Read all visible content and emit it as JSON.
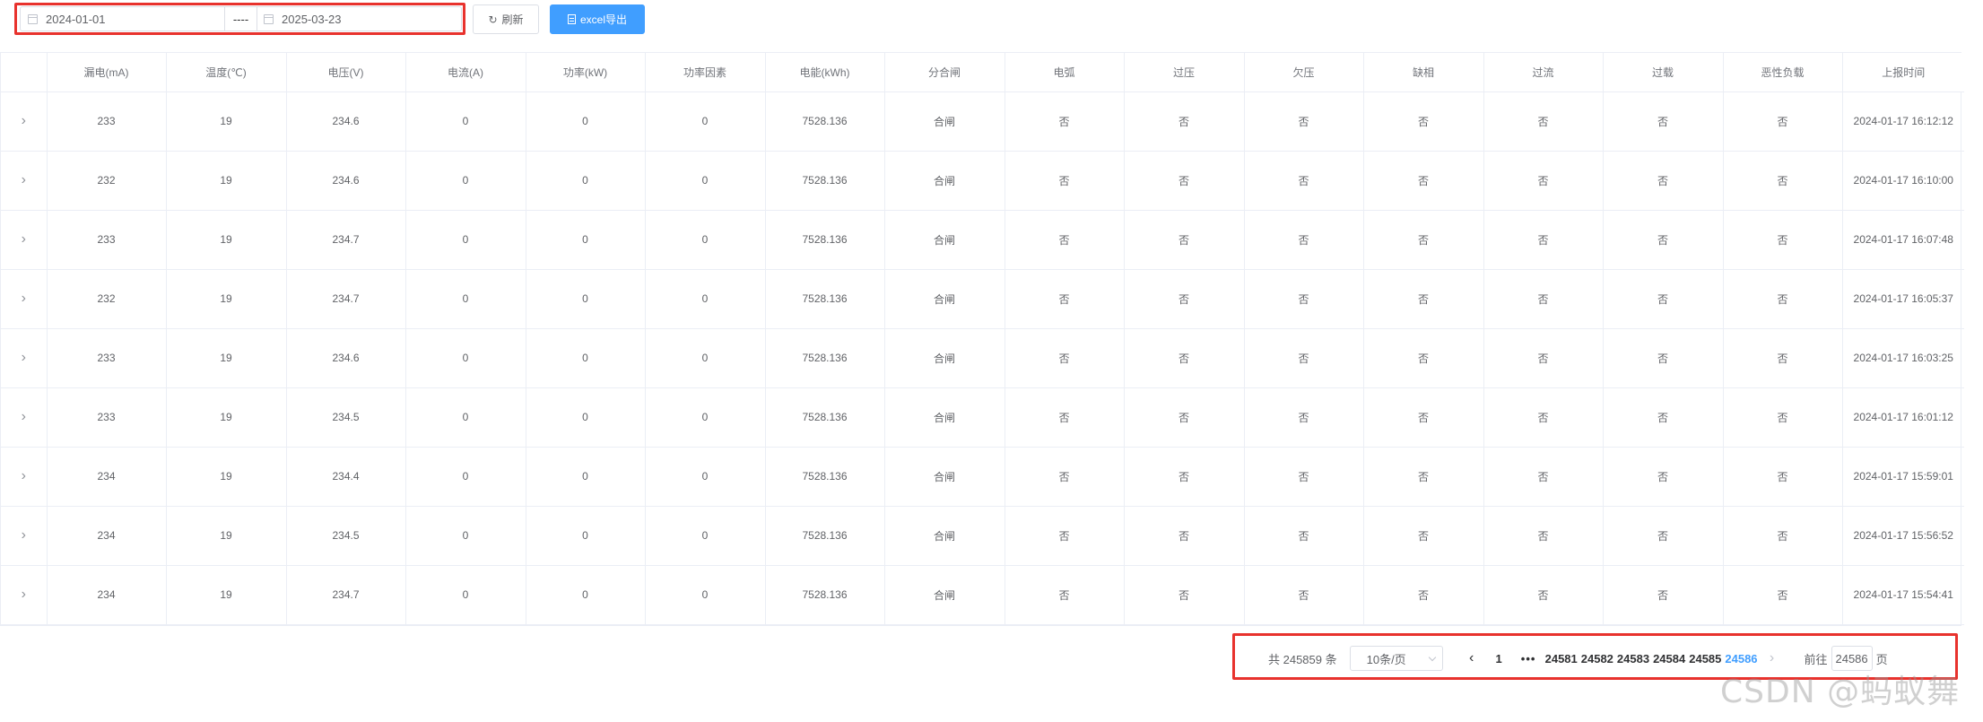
{
  "toolbar": {
    "date_start": "2024-01-01",
    "date_separator": "----",
    "date_end": "2025-03-23",
    "refresh_label": "刷新",
    "export_label": "excel导出"
  },
  "table": {
    "headers": [
      "",
      "漏电(mA)",
      "温度(℃)",
      "电压(V)",
      "电流(A)",
      "功率(kW)",
      "功率因素",
      "电能(kWh)",
      "分合闸",
      "电弧",
      "过压",
      "欠压",
      "缺相",
      "过流",
      "过载",
      "恶性负载",
      "上报时间"
    ],
    "rows": [
      [
        "233",
        "19",
        "234.6",
        "0",
        "0",
        "0",
        "7528.136",
        "合闸",
        "否",
        "否",
        "否",
        "否",
        "否",
        "否",
        "否",
        "2024-01-17 16:12:12"
      ],
      [
        "232",
        "19",
        "234.6",
        "0",
        "0",
        "0",
        "7528.136",
        "合闸",
        "否",
        "否",
        "否",
        "否",
        "否",
        "否",
        "否",
        "2024-01-17 16:10:00"
      ],
      [
        "233",
        "19",
        "234.7",
        "0",
        "0",
        "0",
        "7528.136",
        "合闸",
        "否",
        "否",
        "否",
        "否",
        "否",
        "否",
        "否",
        "2024-01-17 16:07:48"
      ],
      [
        "232",
        "19",
        "234.7",
        "0",
        "0",
        "0",
        "7528.136",
        "合闸",
        "否",
        "否",
        "否",
        "否",
        "否",
        "否",
        "否",
        "2024-01-17 16:05:37"
      ],
      [
        "233",
        "19",
        "234.6",
        "0",
        "0",
        "0",
        "7528.136",
        "合闸",
        "否",
        "否",
        "否",
        "否",
        "否",
        "否",
        "否",
        "2024-01-17 16:03:25"
      ],
      [
        "233",
        "19",
        "234.5",
        "0",
        "0",
        "0",
        "7528.136",
        "合闸",
        "否",
        "否",
        "否",
        "否",
        "否",
        "否",
        "否",
        "2024-01-17 16:01:12"
      ],
      [
        "234",
        "19",
        "234.4",
        "0",
        "0",
        "0",
        "7528.136",
        "合闸",
        "否",
        "否",
        "否",
        "否",
        "否",
        "否",
        "否",
        "2024-01-17 15:59:01"
      ],
      [
        "234",
        "19",
        "234.5",
        "0",
        "0",
        "0",
        "7528.136",
        "合闸",
        "否",
        "否",
        "否",
        "否",
        "否",
        "否",
        "否",
        "2024-01-17 15:56:52"
      ],
      [
        "234",
        "19",
        "234.7",
        "0",
        "0",
        "0",
        "7528.136",
        "合闸",
        "否",
        "否",
        "否",
        "否",
        "否",
        "否",
        "否",
        "2024-01-17 15:54:41"
      ]
    ]
  },
  "pagination": {
    "total_text": "共 245859 条",
    "page_size": "10条/页",
    "first_page": "1",
    "ellipsis": "•••",
    "pages": [
      "24581",
      "24582",
      "24583",
      "24584",
      "24585",
      "24586"
    ],
    "current_page": "24586",
    "goto_label": "前往",
    "goto_value": "24586",
    "page_suffix": "页"
  },
  "watermark": "CSDN @蚂蚁舞",
  "colors": {
    "primary": "#409eff",
    "highlight_box": "#e8322d",
    "border": "#ebeef5"
  },
  "icons": {
    "calendar": "calendar-icon",
    "refresh": "refresh-icon",
    "export": "document-icon",
    "expand": "chevron-right-icon"
  }
}
